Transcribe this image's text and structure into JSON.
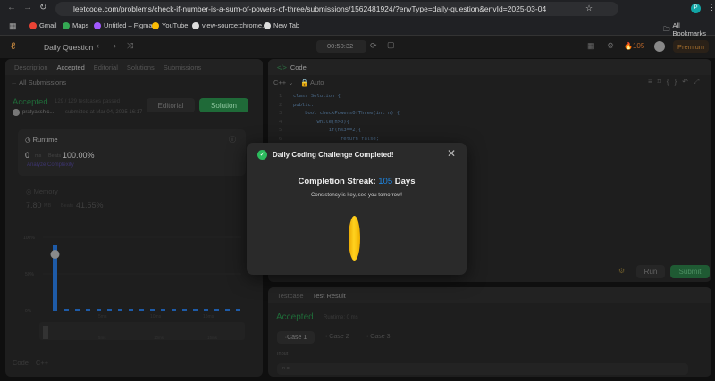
{
  "browser": {
    "url": "leetcode.com/problems/check-if-number-is-a-sum-of-powers-of-three/submissions/1562481924/?envType=daily-question&envId=2025-03-04",
    "bookmarks": [
      "Gmail",
      "Maps",
      "Untitled – Figma",
      "YouTube",
      "view-source:chrome...",
      "New Tab"
    ],
    "all_bookmarks": "All Bookmarks",
    "profile_initial": "P"
  },
  "nav": {
    "title": "Daily Question",
    "timer": "00:50:32",
    "streak": "105",
    "premium": "Premium"
  },
  "left": {
    "tabs": [
      "Description",
      "Accepted",
      "Editorial",
      "Solutions",
      "Submissions"
    ],
    "back": "All Submissions",
    "status": "Accepted",
    "passed": "129 / 129 testcases passed",
    "user": "pratyakshic...",
    "submitted": "submitted at Mar 04, 2025 16:17",
    "editorial_btn": "Editorial",
    "solution_btn": "Solution",
    "runtime": {
      "label": "Runtime",
      "value": "0",
      "unit": "ms",
      "beats_label": "Beats",
      "beats": "100.00%",
      "analyze": "Analyze Complexity"
    },
    "memory": {
      "label": "Memory",
      "value": "7.80",
      "unit": "MB",
      "beats_label": "Beats",
      "beats": "41.55%"
    },
    "chart": {
      "yticks": [
        "100%",
        "50%",
        "0%"
      ],
      "xticks": [
        "5ms",
        "10ms",
        "15ms"
      ],
      "mini_ticks": [
        "5ms",
        "10ms",
        "15ms"
      ]
    },
    "code_label": "Code",
    "lang": "C++"
  },
  "code": {
    "title": "Code",
    "lang": "C++",
    "mode": "Auto",
    "lines": [
      "class Solution {",
      "public:",
      "    bool checkPowersOfThree(int n) {",
      "        while(n>0){",
      "            if(n%3==2){",
      "                return false;"
    ]
  },
  "actions": {
    "run": "Run",
    "submit": "Submit"
  },
  "test": {
    "tabs": [
      "Testcase",
      "Test Result"
    ],
    "status": "Accepted",
    "runtime": "Runtime: 0 ms",
    "cases": [
      "Case 1",
      "Case 2",
      "Case 3"
    ],
    "input_label": "Input",
    "input_value": "n ="
  },
  "modal": {
    "title": "Daily Coding Challenge Completed!",
    "streak_label": "Completion Streak:",
    "streak": "105",
    "days": "Days",
    "message": "Consistency is key, see you tomorrow!"
  },
  "colors": {
    "green": "#2cbb5d",
    "blue": "#1e88e5",
    "gold": "#f5b800"
  }
}
